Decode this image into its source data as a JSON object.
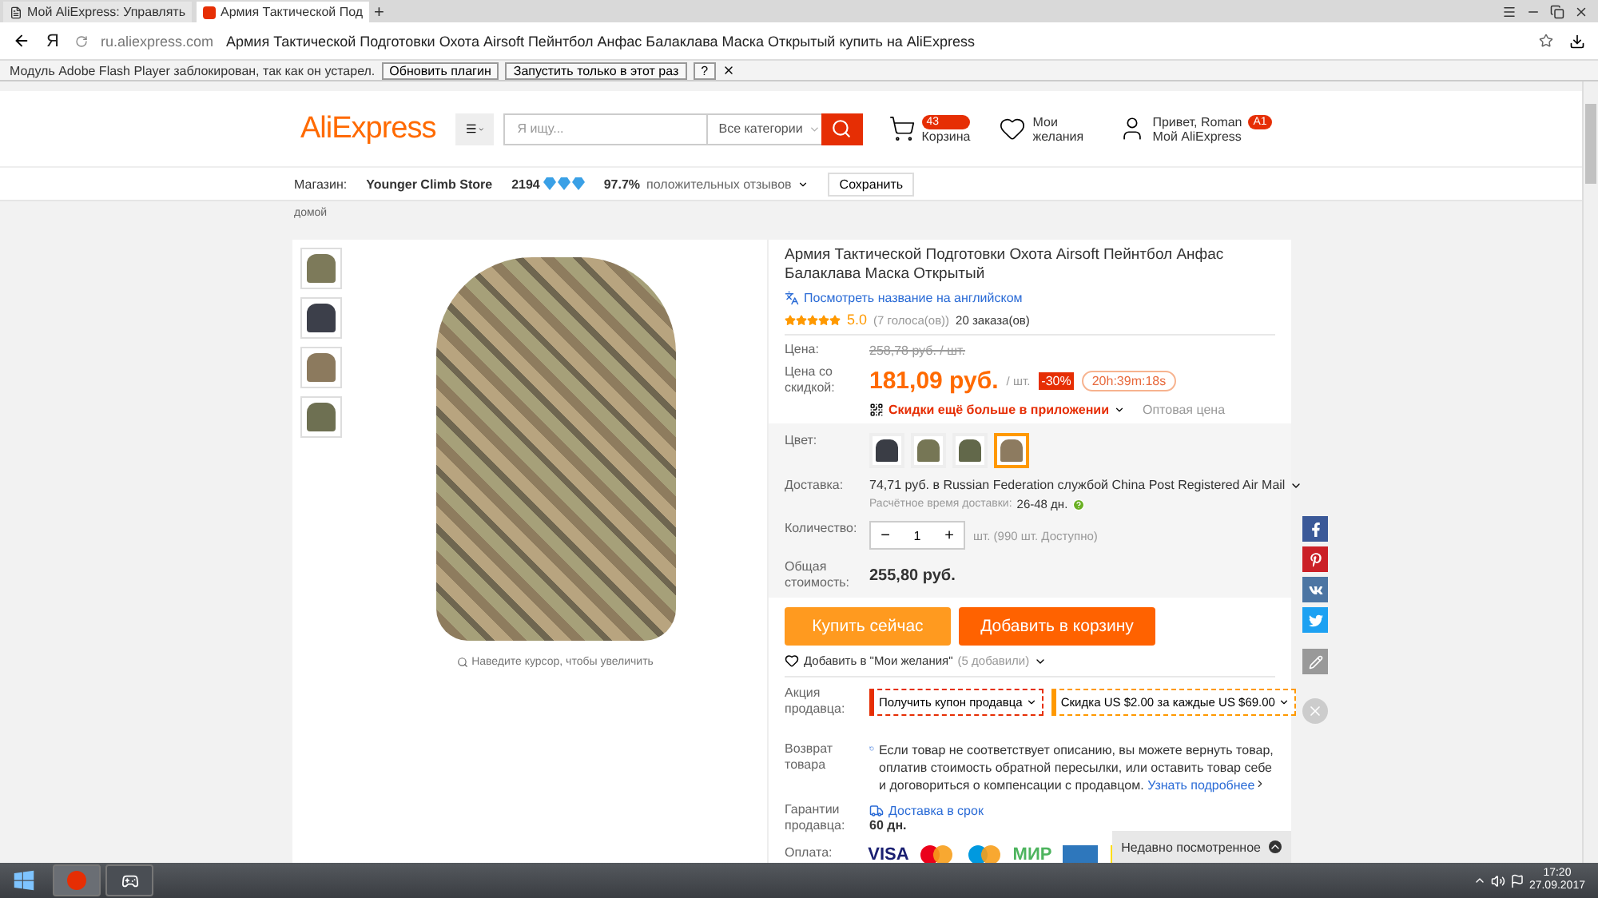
{
  "browser": {
    "tabs": [
      {
        "title": "Мой AliExpress: Управлять",
        "selected": false
      },
      {
        "title": "Армия Тактической Под",
        "selected": true
      }
    ],
    "new_tab": "+",
    "yandex": "Я",
    "url_host": "ru.aliexpress.com",
    "url_title": "Армия Тактической Подготовки Охота Airsoft Пейнтбол Анфас Балаклава Маска Открытый купить на AliExpress",
    "infobar": {
      "message": "Модуль Adobe Flash Player заблокирован, так как он устарел.",
      "buttons": [
        "Обновить плагин",
        "Запустить только в этот раз",
        "?"
      ]
    }
  },
  "header": {
    "logo": "AliExpress",
    "search_placeholder": "Я ищу...",
    "category": "Все категории",
    "cart": {
      "count": "43",
      "label": "Корзина"
    },
    "wishlist": "Мои желания",
    "user": {
      "greeting": "Привет, Roman",
      "badge": "A1",
      "link": "Мой AliExpress"
    }
  },
  "store": {
    "label": "Магазин:",
    "name": "Younger Climb Store",
    "score": "2194",
    "rating": "97.7%",
    "feedback": "положительных отзывов",
    "save": "Сохранить"
  },
  "breadcrumb": "домой",
  "gallery": {
    "thumbnails": [
      {
        "color": "#7d7a5a",
        "selected": false
      },
      {
        "color": "#3c3f4a",
        "selected": false
      },
      {
        "color": "#8c7a5e",
        "selected": false
      },
      {
        "color": "#6e7052",
        "selected": false
      }
    ],
    "zoom_hint": "Наведите курсор, чтобы увеличить"
  },
  "product": {
    "title": "Армия Тактической Подготовки Охота Airsoft Пейнтбол Анфас Балаклава Маска Открытый",
    "translate": "Посмотреть название на английском",
    "stars": 5,
    "rating": "5.0",
    "votes": "(7 голоса(ов))",
    "orders": "20 заказа(ов)",
    "price_label": "Цена:",
    "old_price": "258,78 руб. / шт.",
    "discount_label": "Цена со скидкой:",
    "price": "181,09 руб.",
    "unit": "/ шт.",
    "discount": "-30%",
    "timer": "20h:39m:18s",
    "app_promo": "Скидки ещё больше в приложении",
    "wholesale": "Оптовая цена",
    "color_label": "Цвет:",
    "colors": [
      {
        "color": "#3a3d45",
        "selected": false
      },
      {
        "color": "#767655",
        "selected": false
      },
      {
        "color": "#62684a",
        "selected": false
      },
      {
        "color": "#8d7b60",
        "selected": true
      }
    ],
    "shipping_label": "Доставка:",
    "shipping": "74,71 руб. в Russian Federation службой China Post Registered Air Mail",
    "delivery_time_label": "Расчётное время доставки:",
    "delivery_time": "26-48 дн.",
    "quantity_label": "Количество:",
    "quantity": "1",
    "minus": "−",
    "plus": "+",
    "available": "шт. (990 шт. Доступно)",
    "total_label": "Общая стоимость:",
    "total": "255,80 руб.",
    "buy": "Купить сейчас",
    "add_to_cart": "Добавить в корзину",
    "wishlist": "Добавить в \"Мои желания\"",
    "wishlist_count": "(5 добавили)",
    "promo_label": "Акция продавца:",
    "coupons": [
      {
        "text": "Получить купон продавца",
        "color": "#e62e04"
      },
      {
        "text": "Скидка US $2.00 за каждые US $69.00",
        "color": "#ff9900"
      }
    ],
    "returns_label": "Возврат товара",
    "returns": "Если товар не соответствует описанию, вы можете вернуть товар, оплатив стоимость обратной пересылки, или оставить товар себе и договориться о компенсации с продавцом.",
    "returns_link": "Узнать подробнее",
    "guarantee_label": "Гарантии продавца:",
    "guarantee": "Доставка в срок",
    "guarantee_days": "60 дн.",
    "payment_label": "Оплата:",
    "payments": [
      {
        "kind": "word",
        "text": "VISA",
        "color": "#1a1f71"
      },
      {
        "kind": "circles",
        "color": "#eb001b"
      },
      {
        "kind": "circles",
        "color": "#0099df"
      },
      {
        "kind": "word",
        "text": "МИР",
        "color": "#4db45e"
      },
      {
        "kind": "card",
        "color": "#2e77bc"
      },
      {
        "kind": "card",
        "color": "#ffdd00"
      }
    ]
  },
  "recently_viewed": "Недавно посмотренное",
  "taskbar": {
    "time": "17:20",
    "date": "27.09.2017"
  }
}
